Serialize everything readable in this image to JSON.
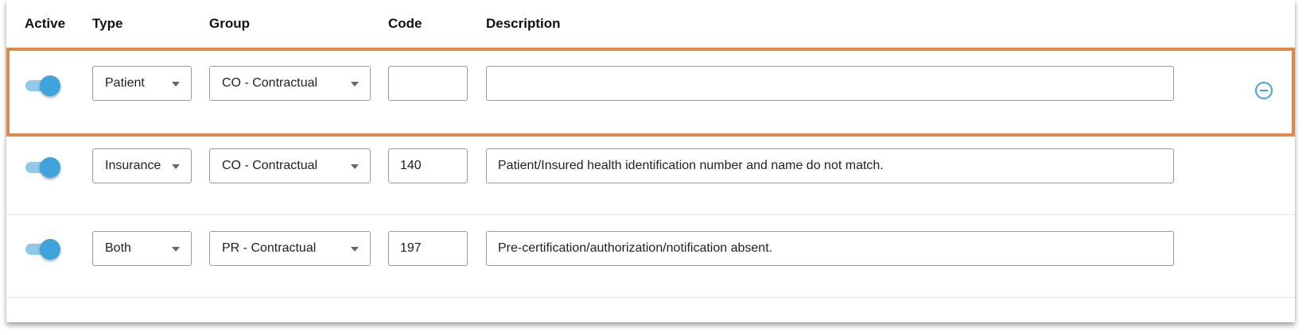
{
  "headers": {
    "active": "Active",
    "type": "Type",
    "group": "Group",
    "code": "Code",
    "description": "Description"
  },
  "rows": [
    {
      "active": true,
      "type": "Patient",
      "group": "CO - Contractual",
      "code": "",
      "description": "",
      "highlighted": true,
      "removable": true
    },
    {
      "active": true,
      "type": "Insurance",
      "group": "CO - Contractual",
      "code": "140",
      "description": "Patient/Insured health identification number and name do not match.",
      "highlighted": false,
      "removable": false
    },
    {
      "active": true,
      "type": "Both",
      "group": "PR - Contractual",
      "code": "197",
      "description": "Pre-certification/authorization/notification absent.",
      "highlighted": false,
      "removable": false
    }
  ],
  "icons": {
    "remove": "minus-circle-icon",
    "dropdown": "caret-down-icon"
  },
  "colors": {
    "toggle_track": "#8fcbe8",
    "toggle_knob": "#3fa3dc",
    "highlight": "#e08a4a",
    "remove_icon": "#3fa3dc"
  }
}
